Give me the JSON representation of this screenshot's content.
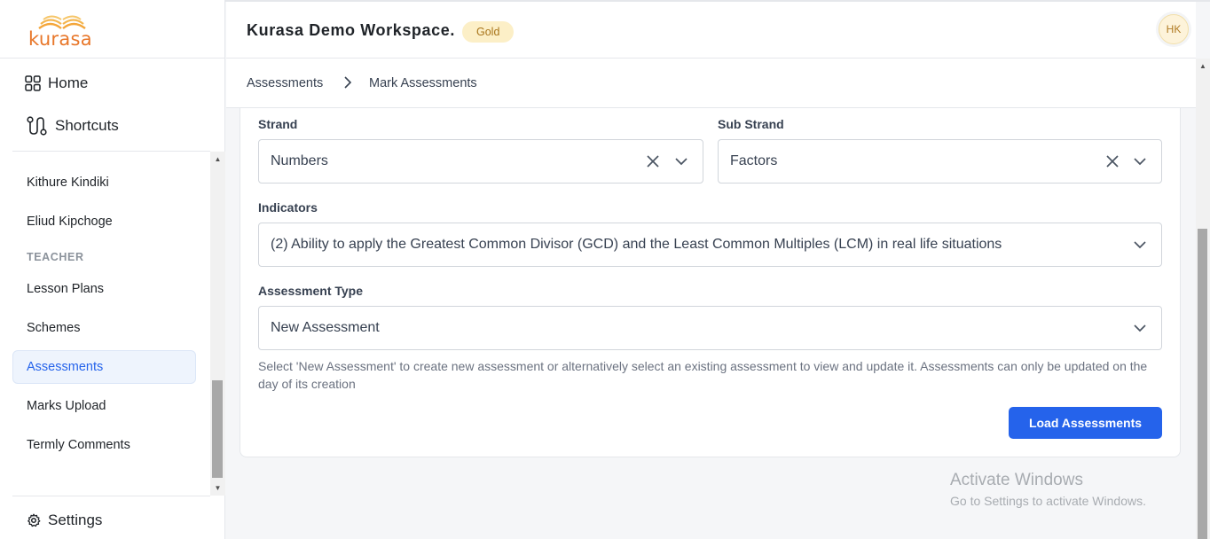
{
  "app": {
    "logo_text": "kurasa"
  },
  "sidebar": {
    "home_label": "Home",
    "shortcuts_label": "Shortcuts",
    "items": [
      {
        "label": "Kithure Kindiki"
      },
      {
        "label": "Eliud Kipchoge"
      }
    ],
    "section_heading": "TEACHER",
    "teacher_items": [
      {
        "label": "Lesson Plans"
      },
      {
        "label": "Schemes"
      },
      {
        "label": "Assessments",
        "active": true
      },
      {
        "label": "Marks Upload"
      },
      {
        "label": "Termly Comments"
      }
    ],
    "settings_label": "Settings"
  },
  "header": {
    "workspace_title": "Kurasa Demo Workspace.",
    "plan_badge": "Gold",
    "avatar_initials": "HK"
  },
  "breadcrumb": {
    "parent": "Assessments",
    "current": "Mark Assessments"
  },
  "form": {
    "strand": {
      "label": "Strand",
      "value": "Numbers"
    },
    "sub_strand": {
      "label": "Sub Strand",
      "value": "Factors"
    },
    "indicators": {
      "label": "Indicators",
      "value": "(2) Ability to apply the Greatest Common Divisor (GCD) and the Least Common Multiples (LCM) in real life situations"
    },
    "assessment_type": {
      "label": "Assessment Type",
      "value": "New Assessment"
    },
    "help_text": "Select 'New Assessment' to create new assessment or alternatively select an existing assessment to view and update it. Assessments can only be updated on the day of its creation",
    "submit_label": "Load Assessments"
  },
  "watermark": {
    "line1": "Activate Windows",
    "line2": "Go to Settings to activate Windows."
  },
  "colors": {
    "accent": "#2563eb",
    "logo": "#e8772a",
    "badge_bg": "#fcefc7",
    "active_bg": "#eef4fd"
  }
}
